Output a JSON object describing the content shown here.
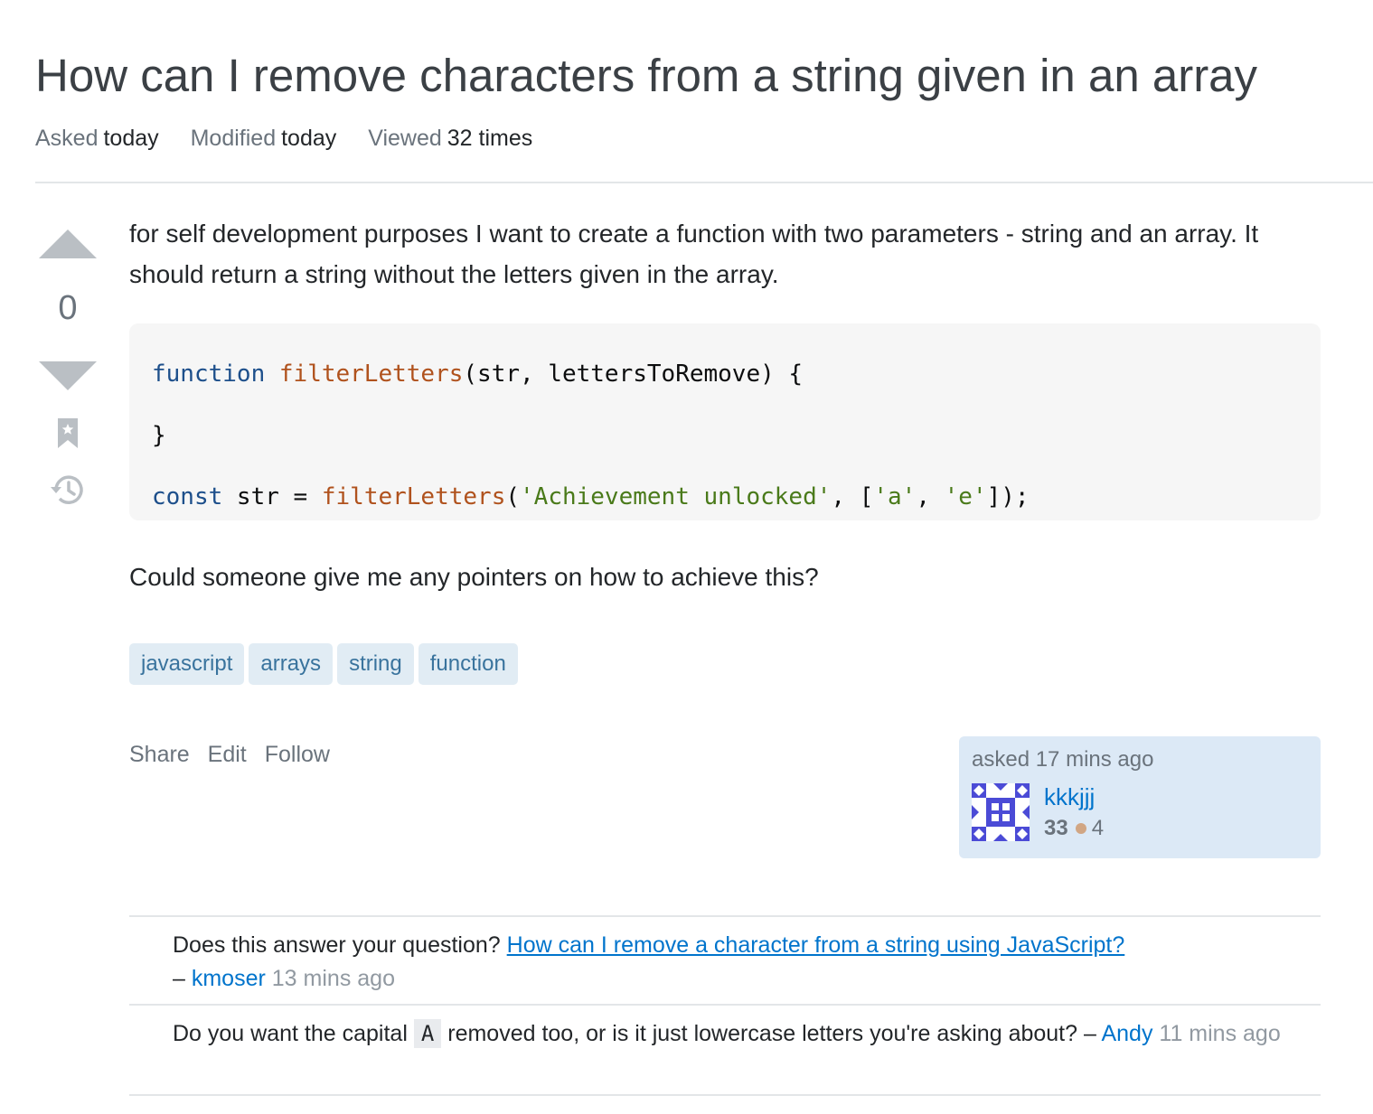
{
  "question": {
    "title": "How can I remove characters from a string given in an array",
    "meta": {
      "asked_label": "Asked",
      "asked_value": "today",
      "modified_label": "Modified",
      "modified_value": "today",
      "viewed_label": "Viewed",
      "viewed_value": "32 times"
    },
    "vote_count": "0",
    "body_paragraph_1": "for self development purposes I want to create a function with two parameters - string and an array. It should return a string without the letters given in the array.",
    "code": {
      "line1_kw": "function",
      "line1_fn": "filterLetters",
      "line1_rest": "(str, lettersToRemove) {",
      "line2": "}",
      "line3_kw": "const",
      "line3_a": " str = ",
      "line3_fn": "filterLetters",
      "line3_b": "(",
      "line3_s1": "'Achievement unlocked'",
      "line3_c": ", [",
      "line3_s2": "'a'",
      "line3_d": ", ",
      "line3_s3": "'e'",
      "line3_e": "]);"
    },
    "body_paragraph_2": "Could someone give me any pointers on how to achieve this?",
    "tags": [
      "javascript",
      "arrays",
      "string",
      "function"
    ],
    "actions": {
      "share": "Share",
      "edit": "Edit",
      "follow": "Follow"
    },
    "owner": {
      "asked_text": "asked 17 mins ago",
      "username": "kkkjjj",
      "reputation": "33",
      "bronze_badges": "4"
    }
  },
  "comments": [
    {
      "text": "Does this answer your question?",
      "link_text": "How can I remove a character from a string using JavaScript?",
      "dash": "–",
      "user": "kmoser",
      "time": "13 mins ago"
    },
    {
      "text_before": "Do you want the capital",
      "code": "A",
      "text_after": "removed too, or is it just lowercase letters you're asking about?",
      "dash": "–",
      "user": "Andy",
      "time": "11 mins ago"
    }
  ],
  "colors": {
    "link": "#0074cc",
    "tag_bg": "#e1ecf4",
    "tag_text": "#39739d",
    "owner_bg": "#dce9f6"
  }
}
